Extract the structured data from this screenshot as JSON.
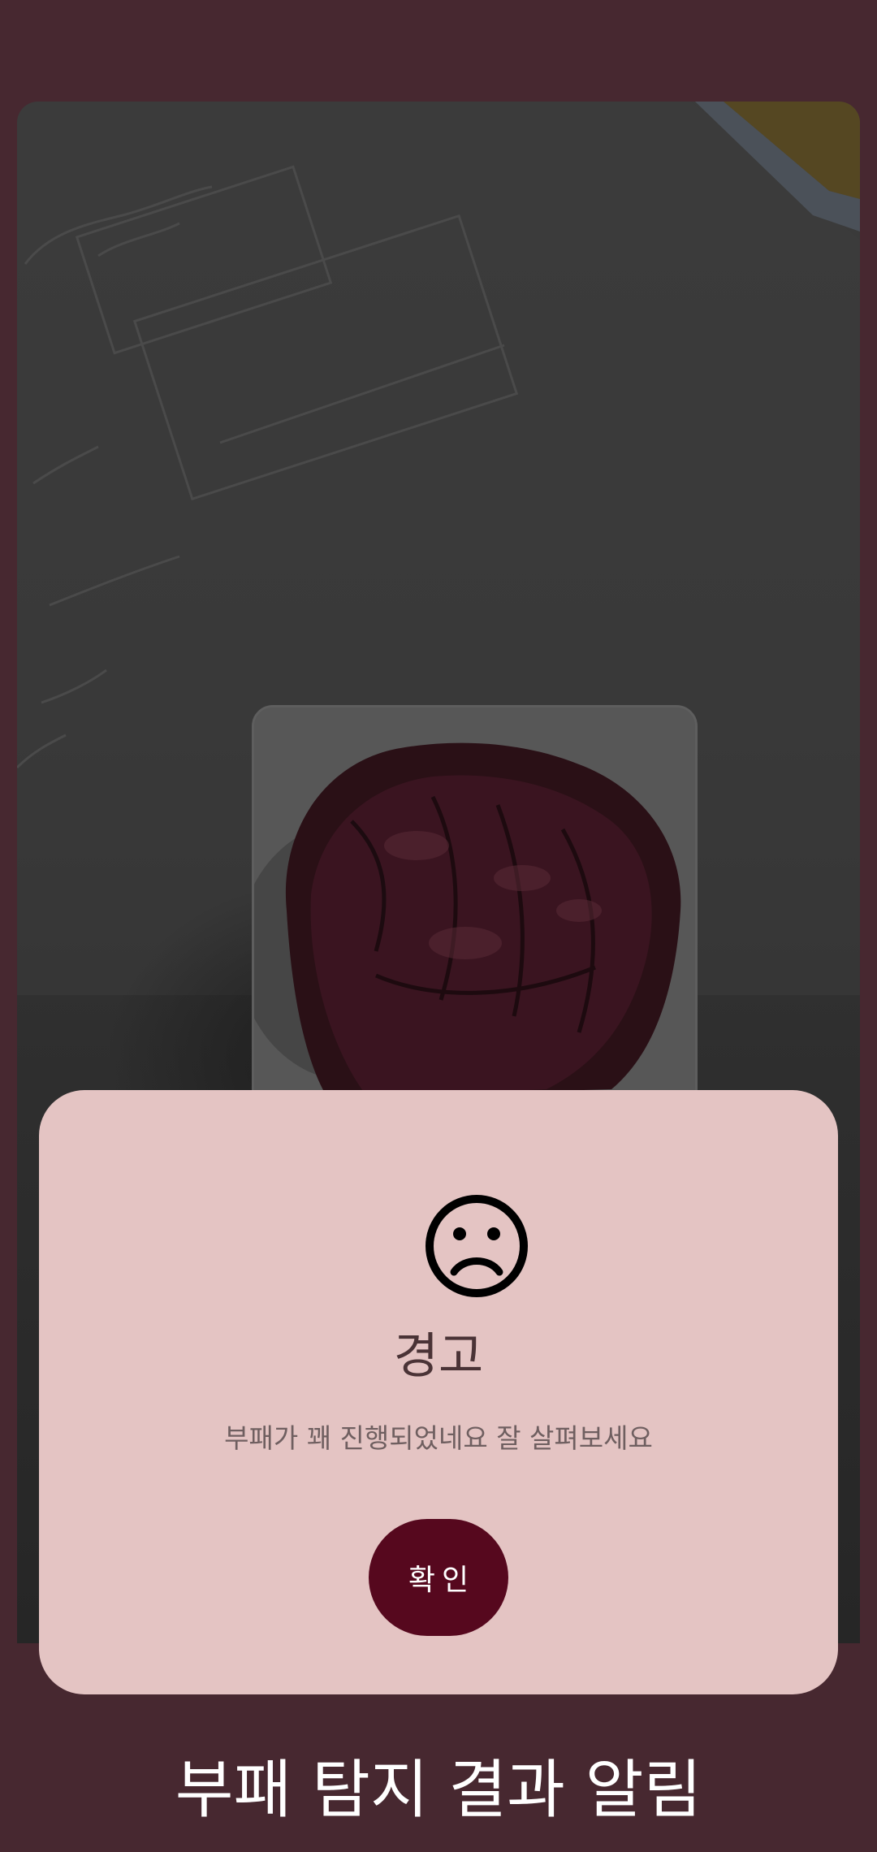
{
  "camera": {
    "preview_label": "camera-preview",
    "captured_item": "fruit-crop"
  },
  "dialog": {
    "icon": "sad-face-icon",
    "title": "경고",
    "message": "부패가 꽤 진행되었네요 잘 살펴보세요",
    "confirm_label": "확인"
  },
  "page": {
    "caption": "부패 탐지 결과 알림"
  },
  "colors": {
    "background": "#472830",
    "dialog_bg": "#e4c4c3",
    "button_bg": "#56081e",
    "button_text": "#ffffff",
    "title_text": "#4a3336",
    "message_text": "#6f5f60"
  }
}
